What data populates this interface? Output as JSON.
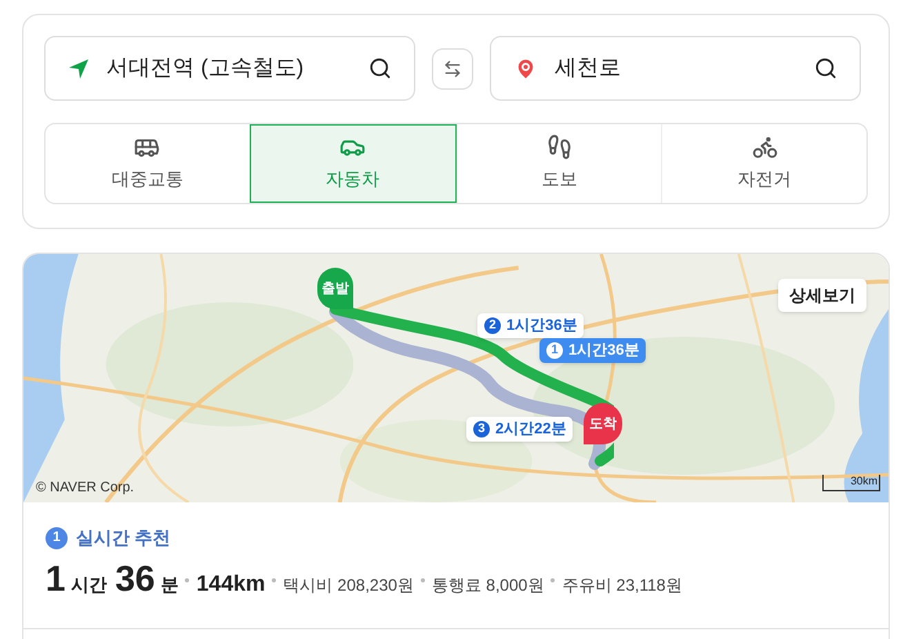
{
  "origin": {
    "value": "서대전역 (고속철도)"
  },
  "destination": {
    "value": "세천로"
  },
  "modes": [
    {
      "label": "대중교통",
      "kind": "bus",
      "selected": false
    },
    {
      "label": "자동차",
      "kind": "car",
      "selected": true
    },
    {
      "label": "도보",
      "kind": "walk",
      "selected": false
    },
    {
      "label": "자전거",
      "kind": "bike",
      "selected": false
    }
  ],
  "map": {
    "kind": "picture",
    "detail_button": "상세보기",
    "start_marker": "출발",
    "end_marker": "도착",
    "copyright": "© NAVER Corp.",
    "scale": "30km",
    "route_labels": [
      {
        "number": "2",
        "time": "1시간36분",
        "selected": false
      },
      {
        "number": "1",
        "time": "1시간36분",
        "selected": true
      },
      {
        "number": "3",
        "time": "2시간22분",
        "selected": false
      }
    ]
  },
  "route": {
    "number": "1",
    "title": "실시간 추천",
    "hours": "1",
    "hours_unit": "시간",
    "minutes": "36",
    "minutes_unit": "분",
    "distance": "144km",
    "costs": [
      "택시비 208,230원",
      "통행료 8,000원",
      "주유비 23,118원"
    ]
  }
}
